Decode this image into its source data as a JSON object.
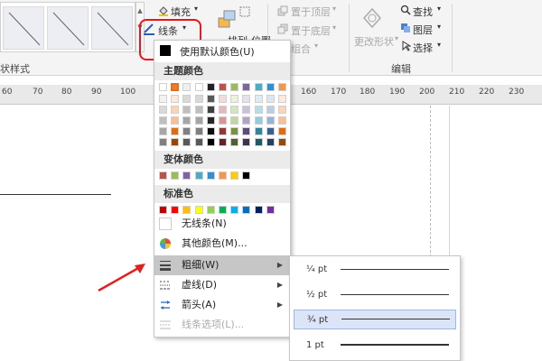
{
  "ribbon": {
    "fill_label": "填充",
    "line_label": "线条",
    "arrange_partial": "排列",
    "position_partial": "位置",
    "bring_front": "置于顶层",
    "send_back": "置于底层",
    "group_label": "组合",
    "change_shape": "更改形状",
    "find": "查找",
    "layers": "图层",
    "select": "选择",
    "shape_styles_partial": "状样式",
    "edit_group": "编辑"
  },
  "ruler": {
    "left_numbers": [
      "60",
      "70",
      "80",
      "90",
      "100"
    ],
    "right_numbers": [
      "160",
      "170",
      "180",
      "190",
      "200",
      "210",
      "220",
      "230"
    ]
  },
  "line_menu": {
    "default_color": "使用默认颜色(U)",
    "theme_colors_header": "主题颜色",
    "theme_top_row": [
      "#ffffff",
      "#f07b28",
      "#f0f0f0",
      "#ffffff",
      "#222222",
      "#c0504d",
      "#9bbb59",
      "#8064a2",
      "#4bacc6",
      "#2f8fd8",
      "#f79646"
    ],
    "theme_shades": [
      [
        "#f2f2f2",
        "#fde9d9",
        "#d9d9d9",
        "#d8d8d8",
        "#595959",
        "#f2dcdb",
        "#ebf1de",
        "#e5e0ec",
        "#dbeef3",
        "#dce6f2",
        "#fdeada"
      ],
      [
        "#d9d9d9",
        "#fbd4b4",
        "#bfbfbf",
        "#bfbfbf",
        "#404040",
        "#e6b9b8",
        "#d7e4bd",
        "#ccc1da",
        "#b7dde8",
        "#b9cde5",
        "#fbd5b5"
      ],
      [
        "#bfbfbf",
        "#f9bf8f",
        "#a6a6a6",
        "#a5a5a5",
        "#262626",
        "#d99694",
        "#c3d69b",
        "#b3a2c7",
        "#93cddd",
        "#95b3d7",
        "#fac08f"
      ],
      [
        "#a6a6a6",
        "#e36c09",
        "#808080",
        "#7f7f7f",
        "#0d0d0d",
        "#953735",
        "#77933c",
        "#604a7b",
        "#31859c",
        "#376092",
        "#e46c0a"
      ],
      [
        "#7f7f7f",
        "#984806",
        "#595959",
        "#595959",
        "#000000",
        "#632523",
        "#4f6228",
        "#403152",
        "#215968",
        "#254061",
        "#984807"
      ]
    ],
    "variant_colors_header": "变体颜色",
    "variant_colors": [
      "#c0504d",
      "#9bbb59",
      "#8064a2",
      "#4bacc6",
      "#2f8fd8",
      "#f79646",
      "#ffcc00",
      "#000000"
    ],
    "standard_colors_header": "标准色",
    "standard_colors": [
      "#c00000",
      "#ff0000",
      "#ffc000",
      "#ffff00",
      "#92d050",
      "#00b050",
      "#00b0f0",
      "#0070c0",
      "#002060",
      "#7030a0"
    ],
    "no_line": "无线条(N)",
    "more_colors": "其他颜色(M)...",
    "weight": "粗细(W)",
    "dashes": "虚线(D)",
    "arrows": "箭头(A)",
    "line_options": "线条选项(L)..."
  },
  "weight_submenu": {
    "items": [
      "¼ pt",
      "½ pt",
      "¾ pt",
      "1 pt"
    ]
  },
  "colors": {
    "highlight_red": "#e8131c",
    "arrow_red": "#e02020"
  }
}
